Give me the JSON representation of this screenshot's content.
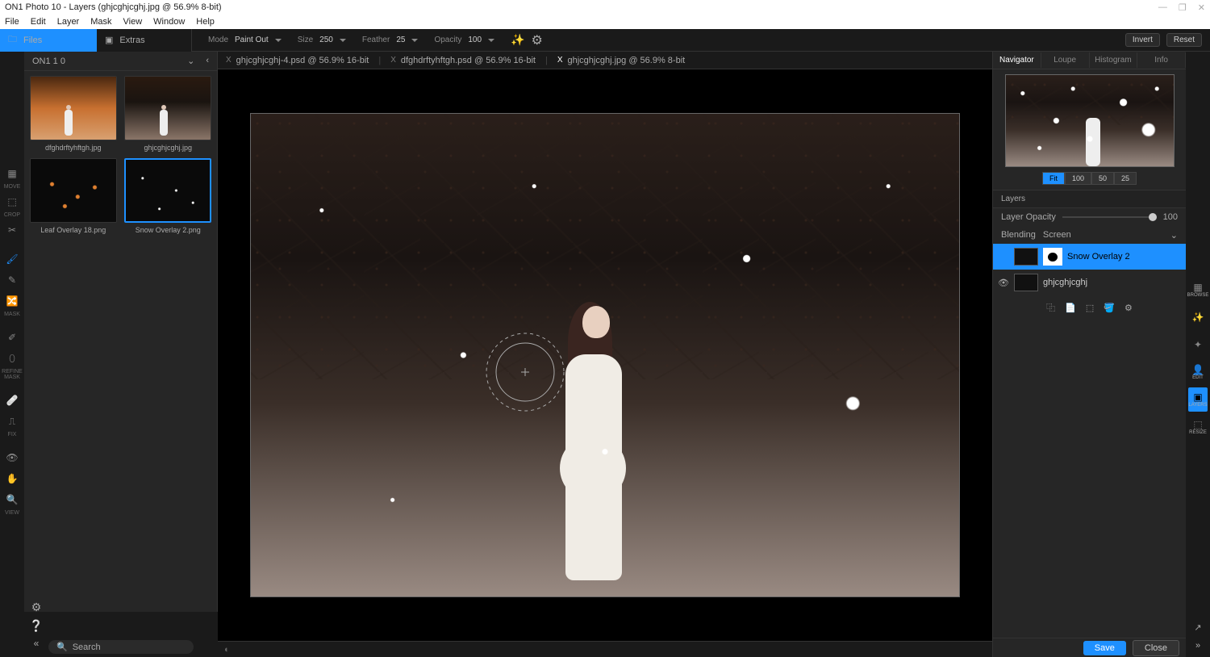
{
  "window": {
    "title": "ON1 Photo 10 - Layers (ghjcghjcghj.jpg @ 56.9% 8-bit)"
  },
  "menu": [
    "File",
    "Edit",
    "Layer",
    "Mask",
    "View",
    "Window",
    "Help"
  ],
  "top_tabs": {
    "files": "Files",
    "extras": "Extras"
  },
  "options": {
    "mode_label": "Mode",
    "mode_value": "Paint Out",
    "size_label": "Size",
    "size_value": "250",
    "feather_label": "Feather",
    "feather_value": "25",
    "opacity_label": "Opacity",
    "opacity_value": "100",
    "invert": "Invert",
    "reset": "Reset"
  },
  "browser": {
    "header": "ON1 1 0",
    "thumbs": [
      {
        "label": "dfghdrftyhftgh.jpg"
      },
      {
        "label": "ghjcghjcghj.jpg"
      },
      {
        "label": "Leaf Overlay 18.png"
      },
      {
        "label": "Snow Overlay 2.png"
      }
    ]
  },
  "doc_tabs": [
    {
      "label": "ghjcghjcghj-4.psd @ 56.9% 16-bit"
    },
    {
      "label": "dfghdrftyhftgh.psd @ 56.9% 16-bit"
    },
    {
      "label": "ghjcghjcghj.jpg @ 56.9% 8-bit"
    }
  ],
  "right_tabs": [
    "Navigator",
    "Loupe",
    "Histogram",
    "Info"
  ],
  "zoom_levels": [
    "Fit",
    "100",
    "50",
    "25"
  ],
  "layers": {
    "header": "Layers",
    "opacity_label": "Layer Opacity",
    "opacity_value": "100",
    "blend_label": "Blending",
    "blend_value": "Screen",
    "items": [
      {
        "name": "Snow Overlay 2"
      },
      {
        "name": "ghjcghjcghj"
      }
    ]
  },
  "right_tools": [
    "BROWSE",
    "",
    "",
    "EDIT",
    "LAYERS",
    "RESIZE"
  ],
  "bottom": {
    "search": "Search",
    "save": "Save",
    "close": "Close"
  }
}
